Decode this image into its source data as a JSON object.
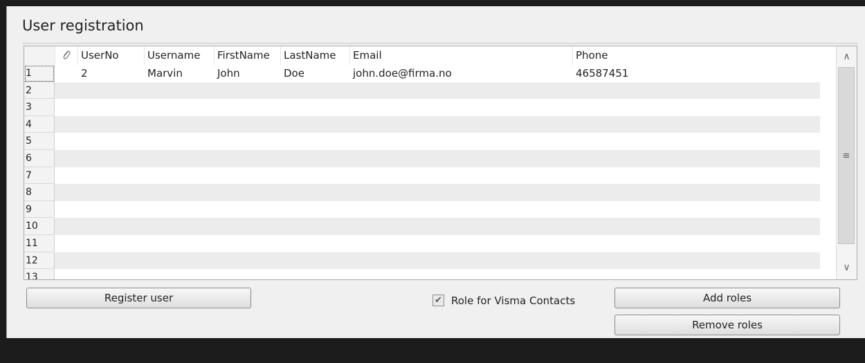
{
  "group": {
    "title": "User registration"
  },
  "grid": {
    "columns": [
      {
        "key": "attach",
        "label": ""
      },
      {
        "key": "userno",
        "label": "UserNo"
      },
      {
        "key": "username",
        "label": "Username"
      },
      {
        "key": "firstname",
        "label": "FirstName"
      },
      {
        "key": "lastname",
        "label": "LastName"
      },
      {
        "key": "email",
        "label": "Email"
      },
      {
        "key": "phone",
        "label": "Phone"
      }
    ],
    "rows": [
      {
        "num": "1",
        "userno": "2",
        "username": "Marvin",
        "firstname": "John",
        "lastname": "Doe",
        "email": "john.doe@firma.no",
        "phone": "46587451"
      },
      {
        "num": "2"
      },
      {
        "num": "3"
      },
      {
        "num": "4"
      },
      {
        "num": "5"
      },
      {
        "num": "6"
      },
      {
        "num": "7"
      },
      {
        "num": "8"
      },
      {
        "num": "9"
      },
      {
        "num": "10"
      },
      {
        "num": "11"
      },
      {
        "num": "12"
      },
      {
        "num": "13"
      }
    ],
    "icons": {
      "attach": "paperclip-icon",
      "scroll_up": "chevron-up-icon",
      "scroll_down": "chevron-down-icon",
      "grip": "grip-icon"
    }
  },
  "actions": {
    "register_user": "Register user",
    "role_checkbox_label": "Role for Visma Contacts",
    "role_checkbox_checked": true,
    "add_roles": "Add roles",
    "remove_roles": "Remove roles"
  }
}
